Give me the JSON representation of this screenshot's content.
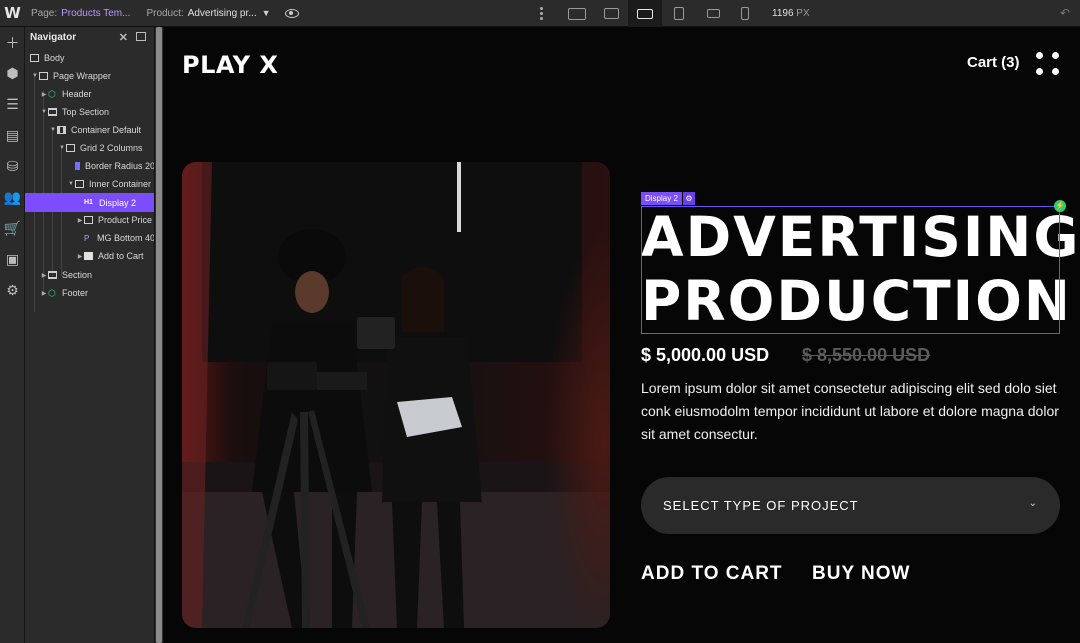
{
  "topbar": {
    "logo": "W",
    "page_label": "Page:",
    "page_value": "Products Tem...",
    "product_label": "Product:",
    "product_value": "Advertising pr...",
    "breakpoint_width": "1196",
    "breakpoint_unit": "PX"
  },
  "navigator": {
    "title": "Navigator",
    "tree": [
      {
        "label": "Body",
        "icon": "body"
      },
      {
        "label": "Page Wrapper",
        "icon": "box"
      },
      {
        "label": "Header",
        "icon": "component"
      },
      {
        "label": "Top Section",
        "icon": "section"
      },
      {
        "label": "Container Default",
        "icon": "container"
      },
      {
        "label": "Grid 2 Columns",
        "icon": "box"
      },
      {
        "label": "Border Radius 20",
        "icon": "image"
      },
      {
        "label": "Inner Container",
        "icon": "box"
      },
      {
        "label": "Display 2",
        "icon": "h1",
        "selected": true
      },
      {
        "label": "Product Price",
        "icon": "box"
      },
      {
        "label": "MG Bottom 40",
        "icon": "paragraph"
      },
      {
        "label": "Add to Cart",
        "icon": "add"
      },
      {
        "label": "Section",
        "icon": "section"
      },
      {
        "label": "Footer",
        "icon": "component"
      }
    ]
  },
  "canvas": {
    "brand": "PLAY X",
    "cart": "Cart (3)",
    "selection_tag": "Display 2",
    "title": "ADVERTISING PRODUCTION",
    "price": "$ 5,000.00 USD",
    "old_price": "$ 8,550.00 USD",
    "description": "Lorem ipsum dolor sit amet consectetur adipiscing elit sed dolo siet conk eiusmodolm tempor incididunt ut labore et dolore magna dolor sit amet consectur.",
    "select_placeholder": "SELECT TYPE OF PROJECT",
    "add_to_cart": "ADD TO CART",
    "buy_now": "BUY NOW"
  },
  "colors": {
    "accent": "#7b4dff",
    "canvas_bg": "#060606",
    "panel_bg": "#2b2b2b",
    "symbol_green": "#2ecc71"
  }
}
